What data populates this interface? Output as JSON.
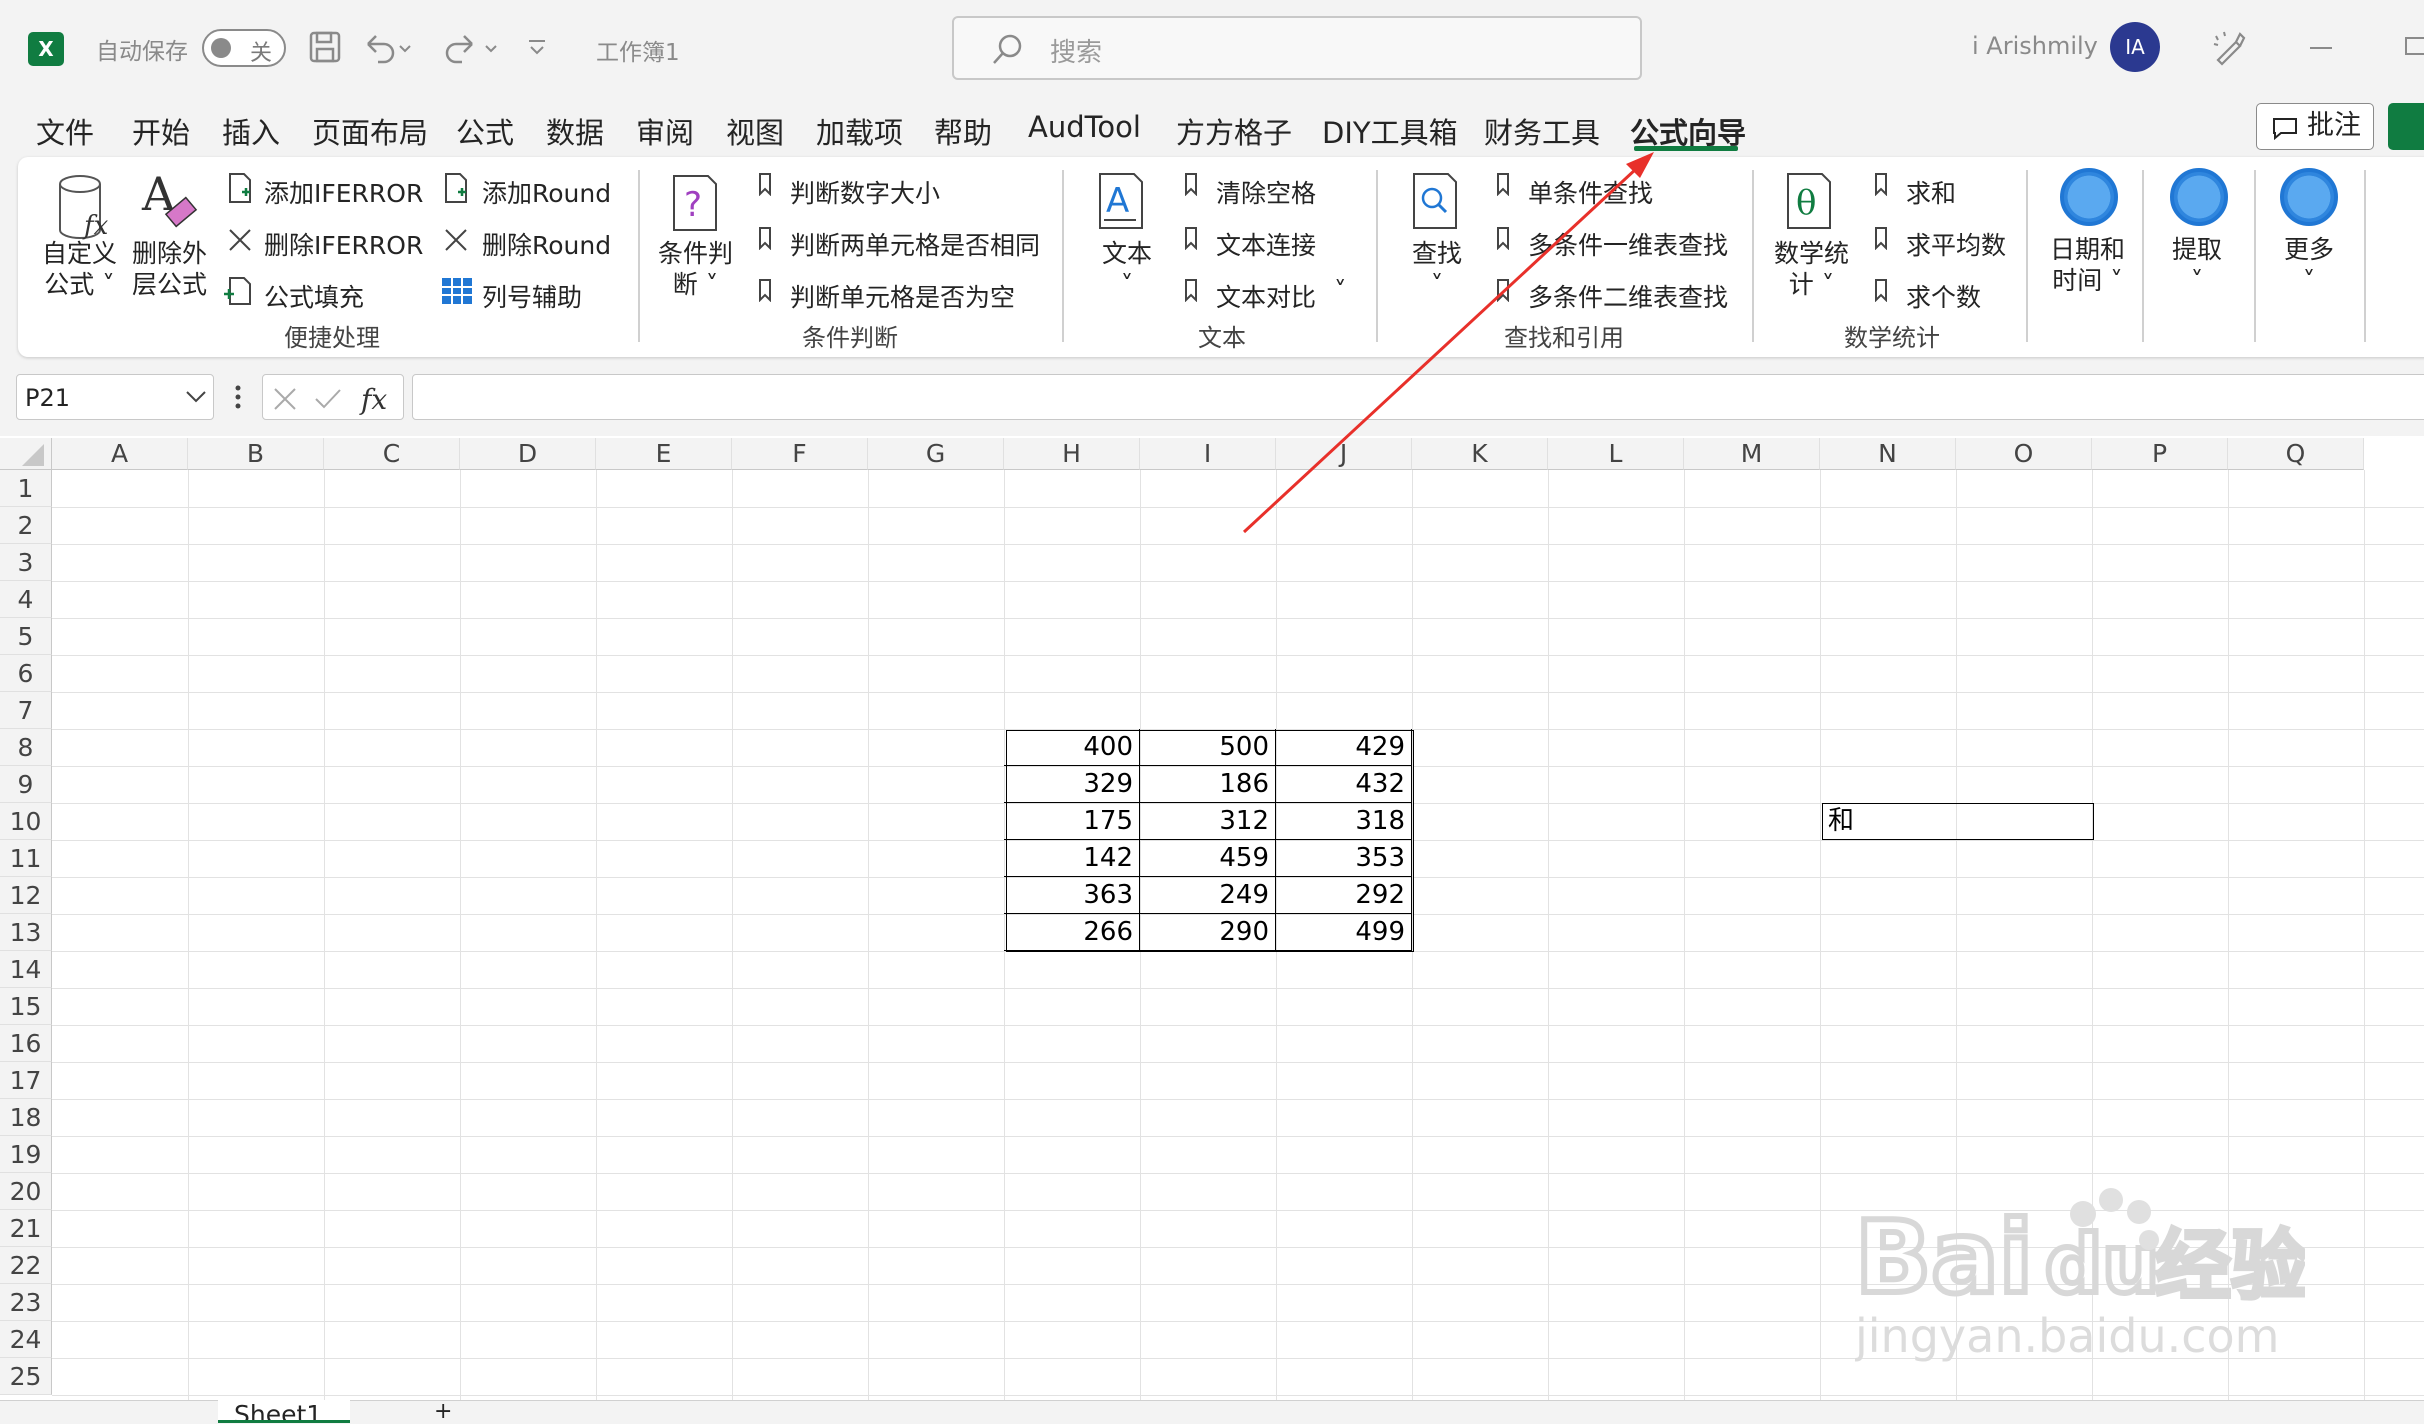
{
  "titlebar": {
    "app_icon": "excel-icon",
    "autosave_label": "自动保存",
    "toggle_state": "关",
    "workbook_name": "工作簿1",
    "search_placeholder": "搜索",
    "user_name": "i Arishmily",
    "avatar_initials": "IA"
  },
  "menu": {
    "items": [
      "文件",
      "开始",
      "插入",
      "页面布局",
      "公式",
      "数据",
      "审阅",
      "视图",
      "加载项",
      "帮助",
      "AudTool",
      "方方格子",
      "DIY工具箱",
      "财务工具",
      "公式向导"
    ],
    "active": "公式向导",
    "comment_label": "批注"
  },
  "ribbon": {
    "group1": {
      "label": "便捷处理",
      "custom_formula": [
        "自定义",
        "公式"
      ],
      "delete_outer": [
        "删除外",
        "层公式"
      ],
      "add_iferror": "添加IFERROR",
      "remove_iferror": "删除IFERROR",
      "formula_fill": "公式填充",
      "add_round": "添加Round",
      "remove_round": "删除Round",
      "col_helper": "列号辅助"
    },
    "group2": {
      "label": "条件判断",
      "cond_judge": [
        "条件判",
        "断"
      ],
      "item1": "判断数字大小",
      "item2": "判断两单元格是否相同",
      "item3": "判断单元格是否为空"
    },
    "group3": {
      "label": "文本",
      "text_btn": "文本",
      "item1": "清除空格",
      "item2": "文本连接",
      "item3": "文本对比"
    },
    "group4": {
      "label": "查找和引用",
      "find_btn": "查找",
      "item1": "单条件查找",
      "item2": "多条件一维表查找",
      "item3": "多条件二维表查找"
    },
    "group5": {
      "label": "数学统计",
      "math_btn": [
        "数学统",
        "计"
      ],
      "item1": "求和",
      "item2": "求平均数",
      "item3": "求个数"
    },
    "date_btn": [
      "日期和",
      "时间"
    ],
    "extract_btn": "提取",
    "more_btn": "更多"
  },
  "formula_bar": {
    "name_box": "P21",
    "formula": ""
  },
  "columns": [
    "A",
    "B",
    "C",
    "D",
    "E",
    "F",
    "G",
    "H",
    "I",
    "J",
    "K",
    "L",
    "M",
    "N",
    "O",
    "P",
    "Q"
  ],
  "rows": [
    "1",
    "2",
    "3",
    "4",
    "5",
    "6",
    "7",
    "8",
    "9",
    "10",
    "11",
    "12",
    "13",
    "14",
    "15",
    "16",
    "17",
    "18",
    "19",
    "20",
    "21",
    "22",
    "23",
    "24",
    "25"
  ],
  "table": {
    "H": [
      "400",
      "329",
      "175",
      "142",
      "363",
      "266"
    ],
    "I": [
      "500",
      "186",
      "312",
      "459",
      "249",
      "290"
    ],
    "J": [
      "429",
      "432",
      "318",
      "353",
      "292",
      "499"
    ]
  },
  "sum_label": "和",
  "sheet_tab": "Sheet1",
  "annotation_color": "#e8302a",
  "accent_color": "#107c41"
}
